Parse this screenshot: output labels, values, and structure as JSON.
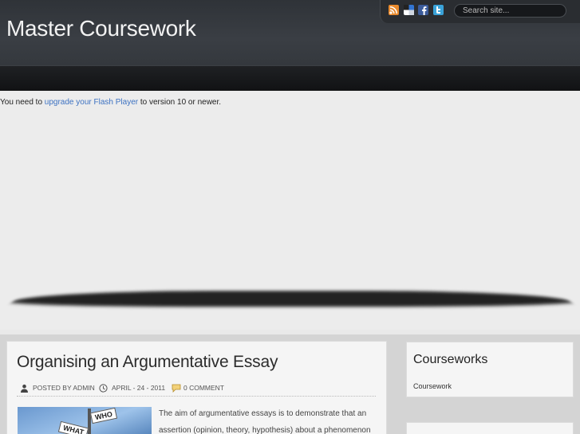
{
  "header": {
    "site_title": "Master Coursework",
    "search_placeholder": "Search site..."
  },
  "social_icons": [
    "rss-icon",
    "delicious-icon",
    "facebook-icon",
    "twitter-icon"
  ],
  "flash_notice": {
    "prefix": "You need to ",
    "link_text": "upgrade your Flash Player",
    "suffix": " to version 10 or newer."
  },
  "post": {
    "title": "Organising an Argumentative Essay",
    "author": "POSTED BY ADMIN",
    "date": "APRIL - 24 - 2011",
    "comments": "0 COMMENT",
    "excerpt_line1": "The aim of argumentative essays is to demonstrate that an",
    "excerpt_line2": "assertion (opinion, theory, hypothesis) about a phenomenon",
    "thumb_sign_1": "WHO",
    "thumb_sign_2": "WHAT"
  },
  "sidebar": {
    "title": "Courseworks",
    "link": "Coursework"
  },
  "colors": {
    "header_bg": "#34383d",
    "link": "#3d72c2",
    "rss": "#e98a2d",
    "facebook": "#3b5b9a",
    "twitter": "#3aa2d8"
  }
}
